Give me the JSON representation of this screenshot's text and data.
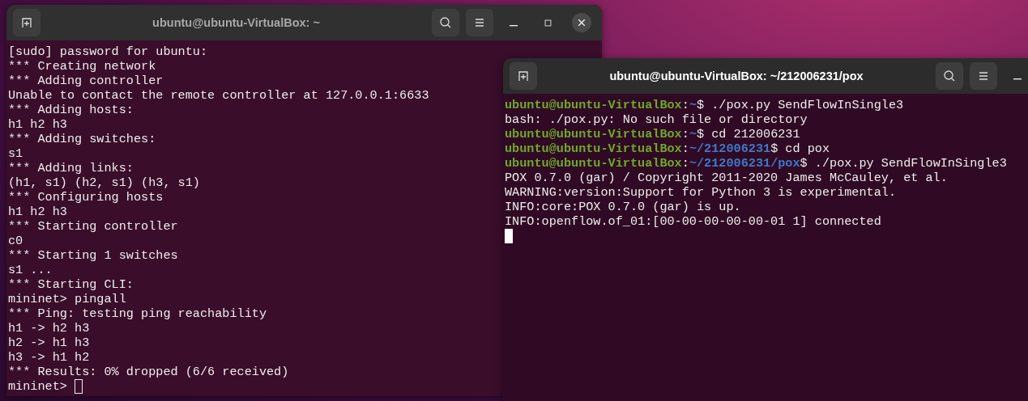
{
  "windows": [
    {
      "title": "ubuntu@ubuntu-VirtualBox: ~",
      "focused": false,
      "lines": [
        {
          "kind": "output",
          "text": "[sudo] password for ubuntu:"
        },
        {
          "kind": "output",
          "text": "*** Creating network"
        },
        {
          "kind": "output",
          "text": "*** Adding controller"
        },
        {
          "kind": "output",
          "text": "Unable to contact the remote controller at 127.0.0.1:6633"
        },
        {
          "kind": "output",
          "text": "*** Adding hosts:"
        },
        {
          "kind": "output",
          "text": "h1 h2 h3"
        },
        {
          "kind": "output",
          "text": "*** Adding switches:"
        },
        {
          "kind": "output",
          "text": "s1"
        },
        {
          "kind": "output",
          "text": "*** Adding links:"
        },
        {
          "kind": "output",
          "text": "(h1, s1) (h2, s1) (h3, s1)"
        },
        {
          "kind": "output",
          "text": "*** Configuring hosts"
        },
        {
          "kind": "output",
          "text": "h1 h2 h3"
        },
        {
          "kind": "output",
          "text": "*** Starting controller"
        },
        {
          "kind": "output",
          "text": "c0"
        },
        {
          "kind": "output",
          "text": "*** Starting 1 switches"
        },
        {
          "kind": "output",
          "text": "s1 ..."
        },
        {
          "kind": "output",
          "text": "*** Starting CLI:"
        },
        {
          "kind": "output",
          "text": "mininet> pingall"
        },
        {
          "kind": "output",
          "text": "*** Ping: testing ping reachability"
        },
        {
          "kind": "output",
          "text": "h1 -> h2 h3"
        },
        {
          "kind": "output",
          "text": "h2 -> h1 h3"
        },
        {
          "kind": "output",
          "text": "h3 -> h1 h2"
        },
        {
          "kind": "output",
          "text": "*** Results: 0% dropped (6/6 received)"
        },
        {
          "kind": "input",
          "text": "mininet>"
        }
      ]
    },
    {
      "title": "ubuntu@ubuntu-VirtualBox: ~/212006231/pox",
      "focused": true,
      "lines": [
        {
          "kind": "prompt",
          "segments": [
            {
              "kind": "user",
              "text": "ubuntu@ubuntu-VirtualBox"
            },
            {
              "kind": "plain",
              "text": ":"
            },
            {
              "kind": "path",
              "text": "~"
            },
            {
              "kind": "plain",
              "text": "$ ./pox.py SendFlowInSingle3"
            }
          ]
        },
        {
          "kind": "output",
          "text": "bash: ./pox.py: No such file or directory"
        },
        {
          "kind": "prompt",
          "segments": [
            {
              "kind": "user",
              "text": "ubuntu@ubuntu-VirtualBox"
            },
            {
              "kind": "plain",
              "text": ":"
            },
            {
              "kind": "path",
              "text": "~"
            },
            {
              "kind": "plain",
              "text": "$ cd 212006231"
            }
          ]
        },
        {
          "kind": "prompt",
          "segments": [
            {
              "kind": "user",
              "text": "ubuntu@ubuntu-VirtualBox"
            },
            {
              "kind": "plain",
              "text": ":"
            },
            {
              "kind": "path",
              "text": "~/212006231"
            },
            {
              "kind": "plain",
              "text": "$ cd pox"
            }
          ]
        },
        {
          "kind": "prompt",
          "segments": [
            {
              "kind": "user",
              "text": "ubuntu@ubuntu-VirtualBox"
            },
            {
              "kind": "plain",
              "text": ":"
            },
            {
              "kind": "path",
              "text": "~/212006231/pox"
            },
            {
              "kind": "plain",
              "text": "$ ./pox.py SendFlowInSingle3"
            }
          ]
        },
        {
          "kind": "output",
          "text": "POX 0.7.0 (gar) / Copyright 2011-2020 James McCauley, et al."
        },
        {
          "kind": "output",
          "text": "WARNING:version:Support for Python 3 is experimental."
        },
        {
          "kind": "output",
          "text": "INFO:core:POX 0.7.0 (gar) is up."
        },
        {
          "kind": "output",
          "text": "INFO:openflow.of_01:[00-00-00-00-00-01 1] connected"
        },
        {
          "kind": "cursor"
        }
      ]
    }
  ]
}
